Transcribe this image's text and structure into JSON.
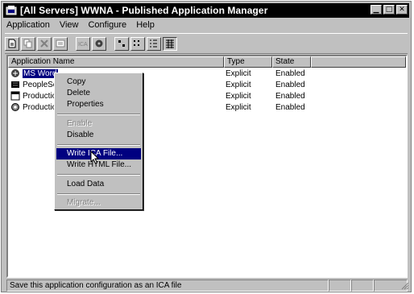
{
  "window": {
    "title": "[All Servers] WWNA - Published Application Manager",
    "buttons": [
      "▁",
      "□",
      "✕"
    ]
  },
  "menubar": {
    "items": [
      "Application",
      "View",
      "Configure",
      "Help"
    ]
  },
  "list": {
    "columns": [
      "Application Name",
      "Type",
      "State"
    ],
    "rows": [
      {
        "name": "MS Word",
        "type": "Explicit",
        "state": "Enabled",
        "icon": "word-app-icon"
      },
      {
        "name": "PeopleSc",
        "type": "Explicit",
        "state": "Enabled",
        "icon": "peoplesoft-app-icon"
      },
      {
        "name": "Productio",
        "type": "Explicit",
        "state": "Enabled",
        "icon": "window-app-icon"
      },
      {
        "name": "Productio",
        "type": "Explicit",
        "state": "Enabled",
        "icon": "gear-app-icon"
      }
    ]
  },
  "context_menu": {
    "copy": "Copy",
    "delete": "Delete",
    "properties": "Properties",
    "enable": "Enable",
    "disable": "Disable",
    "write_ica": "Write ICA File...",
    "write_html": "Write HTML File...",
    "load_data": "Load Data",
    "migrate": "Migrate..."
  },
  "statusbar": {
    "text": "Save this application configuration as an ICA file"
  }
}
